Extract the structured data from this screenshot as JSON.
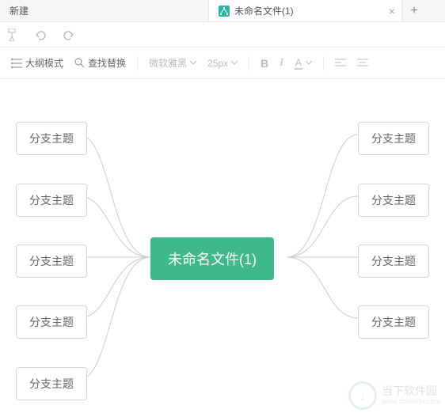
{
  "tabs": {
    "inactive": "新建",
    "active": "未命名文件(1)",
    "close": "×",
    "add": "+"
  },
  "toolbar": {
    "outline": "大纲模式",
    "find": "查找替换",
    "font": "微软雅黑",
    "size": "25px",
    "bold": "B",
    "italic": "I",
    "fontcolor": "A"
  },
  "mindmap": {
    "center": "未命名文件(1)",
    "left": [
      "分支主题",
      "分支主题",
      "分支主题",
      "分支主题",
      "分支主题"
    ],
    "right": [
      "分支主题",
      "分支主题",
      "分支主题",
      "分支主题"
    ]
  },
  "watermark": {
    "title": "当下软件园",
    "url": "www.downxia.com"
  },
  "colors": {
    "accent": "#3fb88b",
    "tabicon": "#29b6a8"
  }
}
